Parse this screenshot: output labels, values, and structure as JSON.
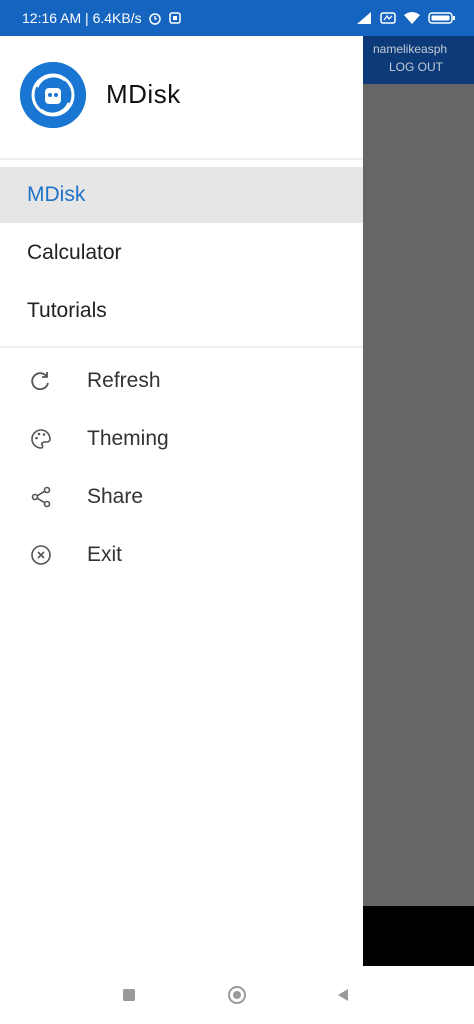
{
  "status_bar": {
    "time_and_speed": "12:16 AM | 6.4KB/s"
  },
  "background_app": {
    "user_text": "namelikeasph",
    "logout_label": "LOG OUT"
  },
  "drawer": {
    "app_title": "MDisk",
    "nav_items": [
      {
        "label": "MDisk",
        "active": true
      },
      {
        "label": "Calculator",
        "active": false
      },
      {
        "label": "Tutorials",
        "active": false
      }
    ],
    "menu_items": [
      {
        "label": "Refresh",
        "icon": "refresh-icon"
      },
      {
        "label": "Theming",
        "icon": "palette-icon"
      },
      {
        "label": "Share",
        "icon": "share-icon"
      },
      {
        "label": "Exit",
        "icon": "exit-icon"
      }
    ]
  },
  "colors": {
    "status_bar": "#1565c0",
    "logo": "#1976d2",
    "active_text": "#1e72c8",
    "scrim": "#666666"
  }
}
